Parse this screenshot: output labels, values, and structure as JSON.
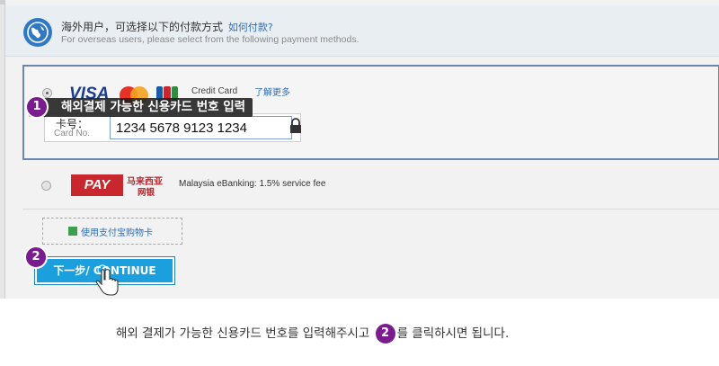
{
  "notice": {
    "title_cn": "海外用户，可选择以下的付款方式",
    "help_link": "如何付款?",
    "subtitle_en": "For overseas users, please select from the following payment methods."
  },
  "credit_card": {
    "brand_visa": "VISA",
    "label": "Credit Card",
    "learn_more": "了解更多",
    "card_label_kr": "卡号：",
    "card_label_en": "Card No.",
    "card_number": "1234 5678 9123 1234"
  },
  "tooltip": {
    "step": "1",
    "text": "해외결제 가능한 신용카드 번호 입력"
  },
  "ebanking": {
    "logo_text": "PAY",
    "logo_cn_1": "马来西亚",
    "logo_cn_2": "网银",
    "label": "Malaysia eBanking: 1.5% service fee"
  },
  "gift_card": {
    "label": "使用支付宝购物卡"
  },
  "continue": {
    "step": "2",
    "label": "下一步/ CONTINUE"
  },
  "caption": {
    "before": "해외 결제가 가능한 신용카드 번호를 입력해주시고",
    "step": "2",
    "after": "를 클릭하시면 됩니다."
  },
  "colors": {
    "accent_blue": "#1ba0dd",
    "step_badge": "#7b1c8e",
    "selected_border": "#6b86b3"
  }
}
